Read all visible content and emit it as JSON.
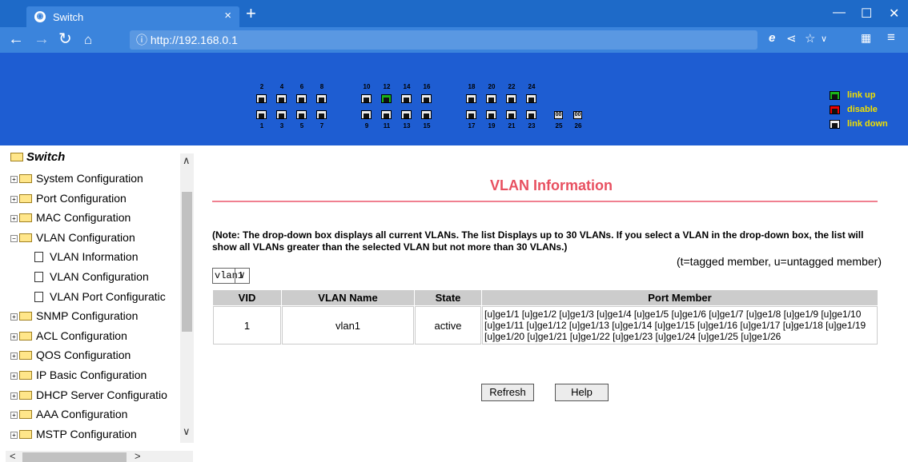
{
  "browser": {
    "tab_title": "Switch",
    "tab_close": "×",
    "new_tab": "+",
    "url": "http://192.168.0.1",
    "window_min": "—",
    "window_max": "☐",
    "window_close": "✕"
  },
  "banner": {
    "top_port_labels": [
      "2",
      "4",
      "6",
      "8",
      "10",
      "12",
      "14",
      "16",
      "18",
      "20",
      "22",
      "24"
    ],
    "bottom_port_labels": [
      "1",
      "3",
      "5",
      "7",
      "9",
      "11",
      "13",
      "15",
      "17",
      "19",
      "21",
      "23"
    ],
    "sfp_labels": [
      "25",
      "26"
    ],
    "active_port": "12",
    "legend": {
      "link_up": "link up",
      "disable": "disable",
      "link_down": "link down"
    },
    "colors": {
      "background": "#1e5dd2",
      "link_up": "#1ab41a",
      "disable": "#e00000",
      "link_down": "#eeeeee",
      "legend_text": "#f0e000"
    }
  },
  "sidebar": {
    "root": "Switch",
    "items": [
      {
        "label": "System Configuration",
        "type": "folder"
      },
      {
        "label": "Port Configuration",
        "type": "folder"
      },
      {
        "label": "MAC Configuration",
        "type": "folder"
      },
      {
        "label": "VLAN Configuration",
        "type": "folder-open"
      },
      {
        "label": "VLAN Information",
        "type": "page"
      },
      {
        "label": "VLAN Configuration",
        "type": "page"
      },
      {
        "label": "VLAN Port Configuratic",
        "type": "page"
      },
      {
        "label": "SNMP Configuration",
        "type": "folder"
      },
      {
        "label": "ACL Configuration",
        "type": "folder"
      },
      {
        "label": "QOS Configuration",
        "type": "folder"
      },
      {
        "label": "IP Basic Configuration",
        "type": "folder"
      },
      {
        "label": "DHCP Server Configuratio",
        "type": "folder"
      },
      {
        "label": "AAA Configuration",
        "type": "folder"
      },
      {
        "label": "MSTP Configuration",
        "type": "folder"
      }
    ]
  },
  "main": {
    "title": "VLAN Information",
    "note": "(Note: The drop-down box displays all current VLANs. The list Displays up to 30 VLANs. If you select a VLAN in the drop-down box, the list will show all VLANs greater than the selected VLAN but not more than 30 VLANs.)",
    "member_legend": "(t=tagged member, u=untagged member)",
    "vlan_select": "vlan1",
    "table": {
      "headers": [
        "VID",
        "VLAN Name",
        "State",
        "Port Member"
      ],
      "rows": [
        {
          "vid": "1",
          "name": "vlan1",
          "state": "active",
          "members": "[u]ge1/1 [u]ge1/2 [u]ge1/3 [u]ge1/4 [u]ge1/5 [u]ge1/6 [u]ge1/7 [u]ge1/8 [u]ge1/9 [u]ge1/10 [u]ge1/11 [u]ge1/12 [u]ge1/13 [u]ge1/14 [u]ge1/15 [u]ge1/16 [u]ge1/17 [u]ge1/18 [u]ge1/19 [u]ge1/20 [u]ge1/21 [u]ge1/22 [u]ge1/23 [u]ge1/24 [u]ge1/25 [u]ge1/26"
        }
      ]
    },
    "refresh_label": "Refresh",
    "help_label": "Help"
  }
}
